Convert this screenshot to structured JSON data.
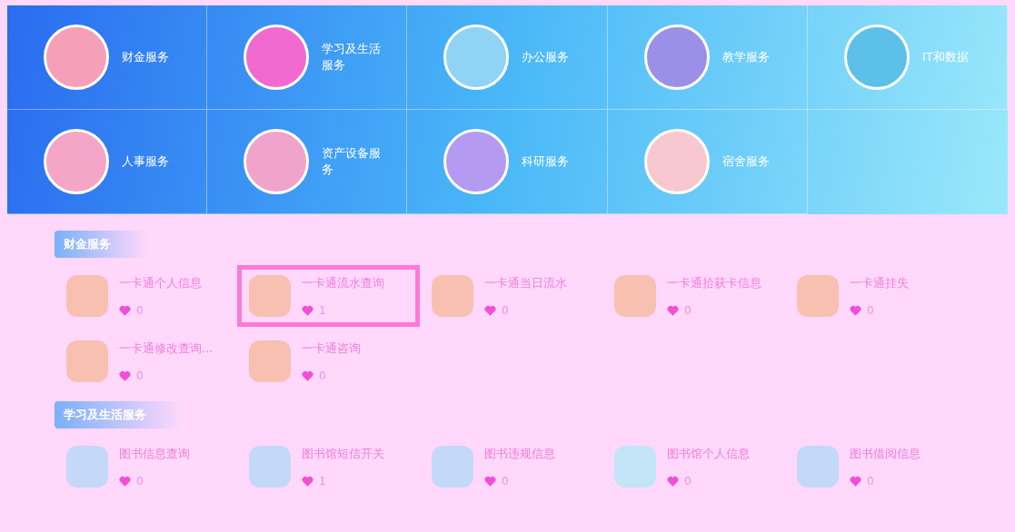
{
  "categories": [
    {
      "label": "财金服务",
      "color": "#f5a0b8"
    },
    {
      "label": "学习及生活服务",
      "color": "#f06ad0"
    },
    {
      "label": "办公服务",
      "color": "#8fd3f5"
    },
    {
      "label": "教学服务",
      "color": "#9c8fe8"
    },
    {
      "label": "IT和数据",
      "color": "#5cc0e8"
    },
    {
      "label": "人事服务",
      "color": "#f3a6c8"
    },
    {
      "label": "资产设备服务",
      "color": "#f0a4cc"
    },
    {
      "label": "科研服务",
      "color": "#b49af0"
    },
    {
      "label": "宿舍服务",
      "color": "#f8c8d0"
    }
  ],
  "sections": [
    {
      "title": "财金服务",
      "items": [
        {
          "name": "一卡通个人信息",
          "likes": "0",
          "selected": false,
          "color": "#f8c0b0"
        },
        {
          "name": "一卡通流水查询",
          "likes": "1",
          "selected": true,
          "color": "#f8c0b0"
        },
        {
          "name": "一卡通当日流水",
          "likes": "0",
          "selected": false,
          "color": "#f8c0b0"
        },
        {
          "name": "一卡通拾获卡信息",
          "likes": "0",
          "selected": false,
          "color": "#f8c0b0"
        },
        {
          "name": "一卡通挂失",
          "likes": "0",
          "selected": false,
          "color": "#f8c0b0"
        },
        {
          "name": "一卡通修改查询...",
          "likes": "0",
          "selected": false,
          "color": "#f8c0b0"
        },
        {
          "name": "一卡通咨询",
          "likes": "0",
          "selected": false,
          "color": "#f8c0b0"
        }
      ]
    },
    {
      "title": "学习及生活服务",
      "items": [
        {
          "name": "图书信息查询",
          "likes": "0",
          "selected": false,
          "color": "#c4d8f8"
        },
        {
          "name": "图书馆短信开关",
          "likes": "1",
          "selected": false,
          "color": "#c4d8f8"
        },
        {
          "name": "图书违规信息",
          "likes": "0",
          "selected": false,
          "color": "#c4d8f8"
        },
        {
          "name": "图书馆个人信息",
          "likes": "0",
          "selected": false,
          "color": "#c4e4f8"
        },
        {
          "name": "图书借阅信息",
          "likes": "0",
          "selected": false,
          "color": "#c4d8f8"
        }
      ]
    }
  ]
}
